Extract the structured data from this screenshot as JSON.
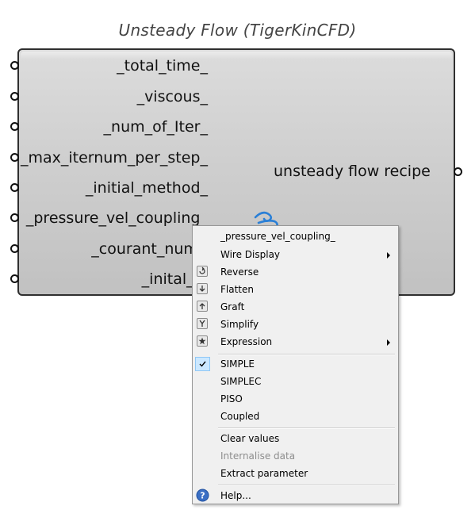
{
  "component": {
    "title": "Unsteady Flow (TigerKinCFD)",
    "inputs": [
      "_total_time_",
      "_viscous_",
      "_num_of_Iter_",
      "_max_iternum_per_step_",
      "_initial_method_",
      "_pressure_vel_coupling_",
      "_courant_numb",
      "_inital_st"
    ],
    "output": "unsteady flow recipe"
  },
  "context_menu": {
    "header": "_pressure_vel_coupling_",
    "items": [
      {
        "label": "Wire Display",
        "submenu": true
      },
      {
        "label": "Reverse",
        "icon": "reverse-icon"
      },
      {
        "label": "Flatten",
        "icon": "flatten-icon"
      },
      {
        "label": "Graft",
        "icon": "graft-icon"
      },
      {
        "label": "Simplify",
        "icon": "simplify-icon"
      },
      {
        "label": "Expression",
        "icon": "expression-icon",
        "submenu": true
      }
    ],
    "options": [
      {
        "label": "SIMPLE",
        "checked": true
      },
      {
        "label": "SIMPLEC",
        "checked": false
      },
      {
        "label": "PISO",
        "checked": false
      },
      {
        "label": "Coupled",
        "checked": false
      }
    ],
    "actions": [
      {
        "label": "Clear values",
        "enabled": true
      },
      {
        "label": "Internalise data",
        "enabled": false
      },
      {
        "label": "Extract parameter",
        "enabled": true
      }
    ],
    "help": "Help..."
  }
}
